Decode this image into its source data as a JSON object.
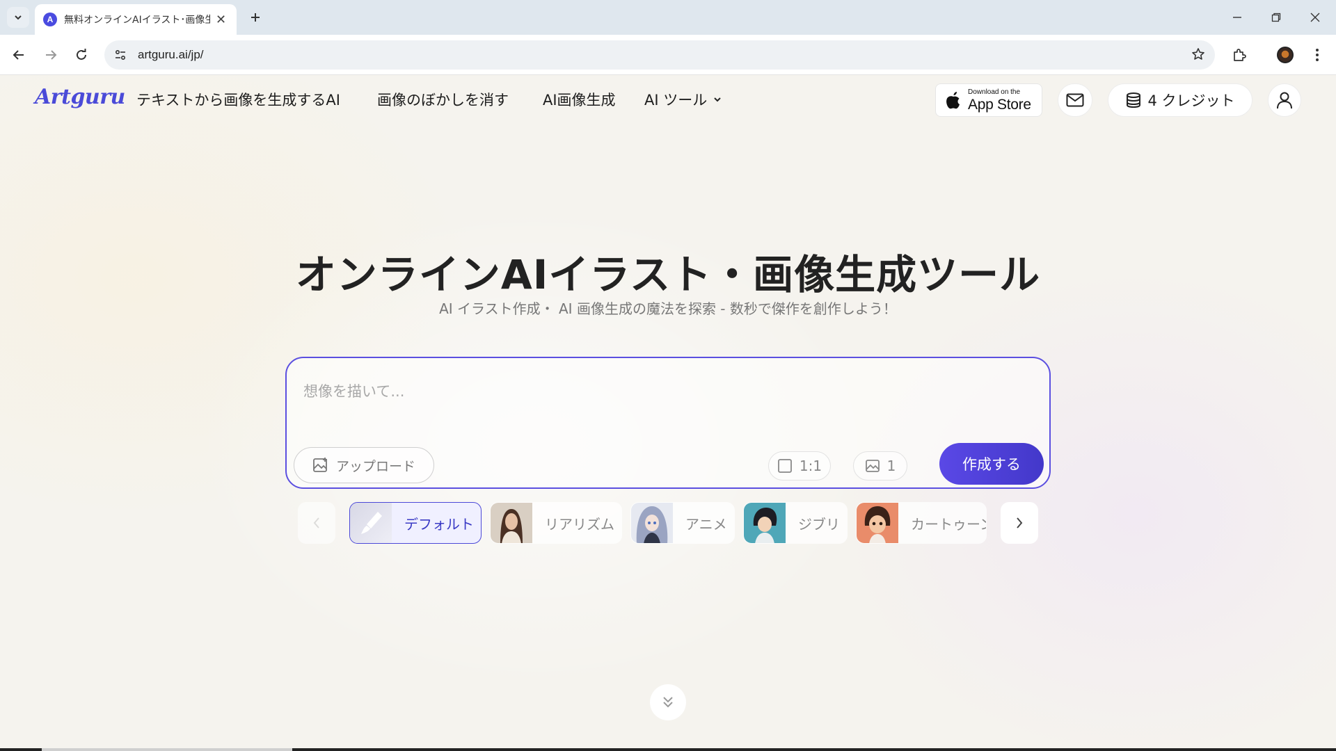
{
  "browser": {
    "tab": {
      "title": "無料オンラインAIイラスト･画像生成",
      "favicon_letter": "A"
    },
    "address_bar": {
      "url": "artguru.ai/jp/"
    }
  },
  "header": {
    "logo": "Artguru",
    "nav": [
      {
        "label": "テキストから画像を生成するAI"
      },
      {
        "label": "画像のぼかしを消す"
      },
      {
        "label": "AI画像生成"
      },
      {
        "label": "AI ツール"
      }
    ],
    "app_store": {
      "small": "Download on the",
      "big": "App Store"
    },
    "credits_label": "4 クレジット"
  },
  "hero": {
    "title": "オンラインAIイラスト・画像生成ツール",
    "subtitle": "AI イラスト作成・ AI 画像生成の魔法を探索 - 数秒で傑作を創作しよう！"
  },
  "prompt": {
    "placeholder": "想像を描いて...",
    "upload_label": "アップロード",
    "aspect_ratio": "1:1",
    "image_count": "1",
    "create_label": "作成する"
  },
  "styles": [
    {
      "label": "デフォルト",
      "selected": true
    },
    {
      "label": "リアリズム",
      "selected": false
    },
    {
      "label": "アニメ",
      "selected": false
    },
    {
      "label": "ジブリ",
      "selected": false
    },
    {
      "label": "カートゥーン",
      "selected": false
    }
  ],
  "colors": {
    "accent": "#4b48d8",
    "button": "#4f42dc"
  }
}
